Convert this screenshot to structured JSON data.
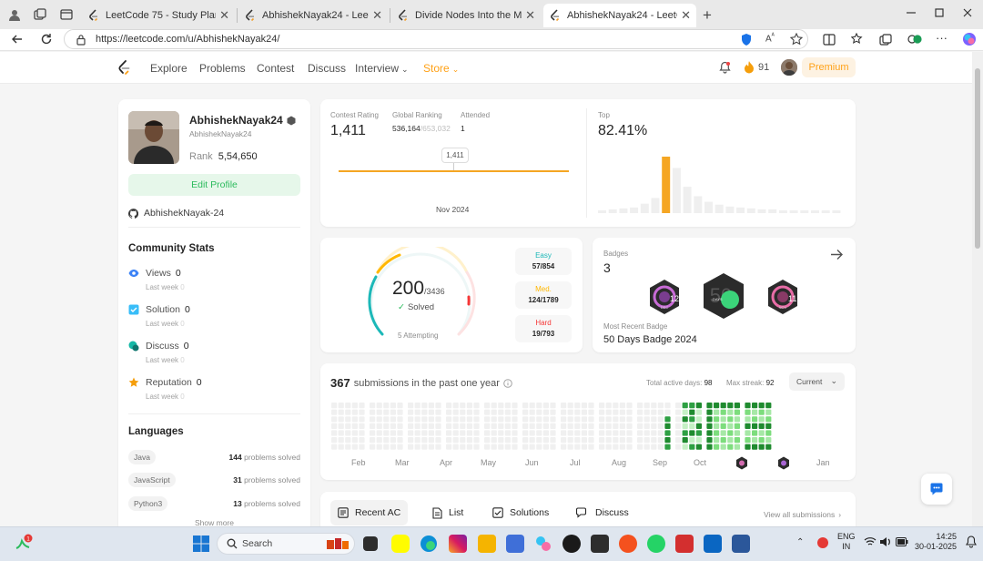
{
  "browser": {
    "tabs": [
      {
        "label": "LeetCode 75 - Study Plan - LeetC"
      },
      {
        "label": "AbhishekNayak24 - LeetCode Pro"
      },
      {
        "label": "Divide Nodes Into the Maximum N"
      },
      {
        "label": "AbhishekNayak24 - LeetCode Pro",
        "active": true
      }
    ],
    "url": "https://leetcode.com/u/AbhishekNayak24/"
  },
  "nav": {
    "items": [
      "Explore",
      "Problems",
      "Contest",
      "Discuss"
    ],
    "interview": "Interview",
    "store": "Store",
    "streak": "91",
    "premium": "Premium"
  },
  "profile": {
    "username": "AbhishekNayak24",
    "handle": "AbhishekNayak24",
    "rank_label": "Rank",
    "rank_value": "5,54,650",
    "edit_profile": "Edit Profile",
    "github": "AbhishekNayak-24"
  },
  "community": {
    "title": "Community Stats",
    "stats": [
      {
        "label": "Views",
        "value": "0",
        "sub": "Last week",
        "sub_value": "0",
        "color": "#3b82f6"
      },
      {
        "label": "Solution",
        "value": "0",
        "sub": "Last week",
        "sub_value": "0",
        "color": "#38bdf8"
      },
      {
        "label": "Discuss",
        "value": "0",
        "sub": "Last week",
        "sub_value": "0",
        "color": "#14b8a6"
      },
      {
        "label": "Reputation",
        "value": "0",
        "sub": "Last week",
        "sub_value": "0",
        "color": "#f59e0b"
      }
    ]
  },
  "languages": {
    "title": "Languages",
    "items": [
      {
        "name": "Java",
        "count": "144",
        "suffix": "problems solved"
      },
      {
        "name": "JavaScript",
        "count": "31",
        "suffix": "problems solved"
      },
      {
        "name": "Python3",
        "count": "13",
        "suffix": "problems solved"
      }
    ],
    "show_more": "Show more"
  },
  "contest": {
    "rating_label": "Contest Rating",
    "rating": "1,411",
    "global_label": "Global Ranking",
    "global_rank": "536,164",
    "global_total": "/653,032",
    "attended_label": "Attended",
    "attended": "1",
    "tooltip": "1,411",
    "date": "Nov 2024",
    "top_label": "Top",
    "top_value": "82.41%"
  },
  "top_histogram": {
    "values": [
      3,
      4,
      5,
      6,
      10,
      16,
      60,
      48,
      28,
      18,
      12,
      9,
      7,
      6,
      5,
      4,
      4,
      3,
      3,
      3,
      2,
      2,
      2
    ],
    "highlight_index": 6,
    "colors": {
      "highlight": "#f5a623",
      "bar": "#efefef"
    }
  },
  "progress": {
    "solved": "200",
    "total": "/3436",
    "solved_label": "Solved",
    "attempting": "5 Attempting",
    "difficulty": [
      {
        "label": "Easy",
        "value": "57/854",
        "color": "#1cb8b8"
      },
      {
        "label": "Med.",
        "value": "124/1789",
        "color": "#ffb700"
      },
      {
        "label": "Hard",
        "value": "19/793",
        "color": "#f63737"
      }
    ]
  },
  "badges": {
    "title": "Badges",
    "count": "3",
    "items": [
      {
        "name": "dec-badge-icon",
        "text": "12",
        "sub": "DEC"
      },
      {
        "name": "50-days-badge-icon",
        "text": "50",
        "sub": "DAYS"
      },
      {
        "name": "nov-badge-icon",
        "text": "11",
        "sub": "NOV"
      }
    ],
    "recent_label": "Most Recent Badge",
    "recent": "50 Days Badge 2024"
  },
  "submissions": {
    "count": "367",
    "text": "submissions in the past one year",
    "active_label": "Total active days:",
    "active_days": "98",
    "streak_label": "Max streak:",
    "max_streak": "92",
    "range": "Current",
    "months": [
      "Feb",
      "Mar",
      "Apr",
      "May",
      "Jun",
      "Jul",
      "Aug",
      "Sep",
      "Oct",
      "Nov",
      "Dec",
      "Jan"
    ]
  },
  "bottom_tabs": {
    "items": [
      "Recent AC",
      "List",
      "Solutions",
      "Discuss"
    ],
    "view_all": "View all submissions"
  },
  "taskbar": {
    "search": "Search",
    "lang_top": "ENG",
    "lang_bottom": "IN",
    "time": "14:25",
    "date": "30-01-2025"
  }
}
